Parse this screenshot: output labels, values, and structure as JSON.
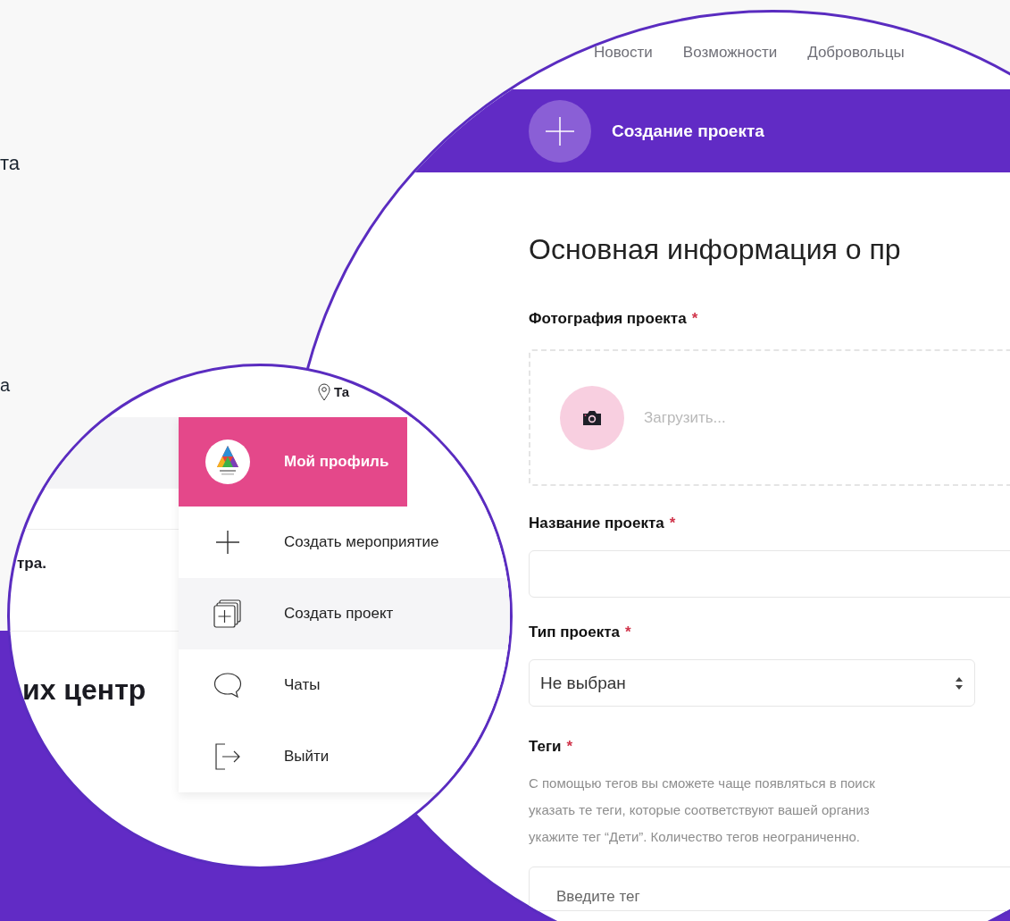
{
  "background": {
    "texts": [
      "та",
      "а"
    ]
  },
  "menu_lens": {
    "location": "Та",
    "fragments": [
      "тра.",
      "их центр"
    ],
    "menu": [
      {
        "kind": "profile",
        "label": "Мой профиль",
        "selected": false
      },
      {
        "kind": "action",
        "label": "Создать мероприятие",
        "selected": false
      },
      {
        "kind": "action",
        "label": "Создать проект",
        "selected": true
      },
      {
        "kind": "action",
        "label": "Чаты",
        "selected": false
      },
      {
        "kind": "action",
        "label": "Выйти",
        "selected": false
      }
    ]
  },
  "form_lens": {
    "nav": [
      "Новости",
      "Возможности",
      "Добровольцы"
    ],
    "header": {
      "title": "Создание проекта"
    },
    "heading": "Основная информация о пр",
    "fields": [
      {
        "kind": "photo",
        "label": "Фотография проекта",
        "mark": "*",
        "upload": "Загрузить..."
      },
      {
        "kind": "text",
        "label": "Название проекта",
        "mark": "*"
      },
      {
        "kind": "select",
        "label": "Тип проекта",
        "mark": "*",
        "value": "Не выбран"
      },
      {
        "kind": "tags",
        "label": "Теги",
        "mark": "*",
        "help": [
          "С помощью тегов вы сможете чаще появляться в поиск",
          "указать те теги, которые соответствуют вашей организ",
          "укажите тег “Дети”. Количество тегов неограниченно."
        ],
        "placeholder": "Введите тег"
      }
    ]
  }
}
